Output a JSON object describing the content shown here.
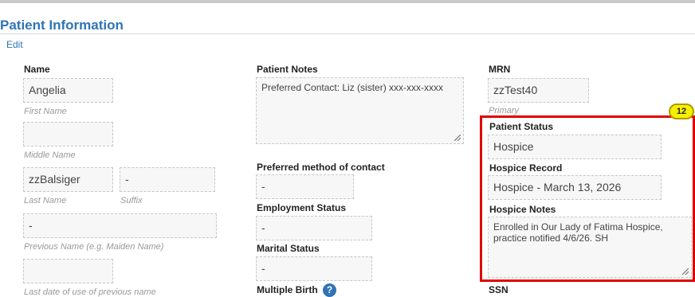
{
  "section": {
    "title": "Patient Information",
    "edit_label": "Edit"
  },
  "name": {
    "label": "Name",
    "first_value": "Angelia",
    "first_caption": "First Name",
    "middle_value": "",
    "middle_caption": "Middle Name",
    "last_value": "zzBalsiger",
    "last_caption": "Last Name",
    "suffix_value": "-",
    "suffix_caption": "Suffix",
    "previous_value": "-",
    "previous_caption": "Previous Name (e.g. Maiden Name)",
    "last_date_value": "",
    "last_date_caption": "Last date of use of previous name"
  },
  "notes": {
    "label": "Patient Notes",
    "value": "Preferred Contact: Liz (sister) xxx-xxx-xxxx"
  },
  "contact": {
    "label": "Preferred method of contact",
    "value": "-"
  },
  "employment": {
    "label": "Employment Status",
    "value": "-"
  },
  "marital": {
    "label": "Marital Status",
    "value": "-"
  },
  "multiple_birth": {
    "label": "Multiple Birth",
    "help_glyph": "?"
  },
  "mrn": {
    "label": "MRN",
    "value": "zzTest40",
    "caption": "Primary"
  },
  "status": {
    "label": "Patient Status",
    "value": "Hospice"
  },
  "hospice_record": {
    "label": "Hospice Record",
    "value": "Hospice - March 13, 2026"
  },
  "hospice_notes": {
    "label": "Hospice Notes",
    "value": "Enrolled in Our Lady of Fatima Hospice, practice notified 4/6/26. SH"
  },
  "ssn": {
    "label": "SSN"
  },
  "annotation": {
    "badge": "12"
  },
  "colors": {
    "accent": "#2f74b5",
    "highlight": "#e00000",
    "badge": "#f6f000"
  }
}
